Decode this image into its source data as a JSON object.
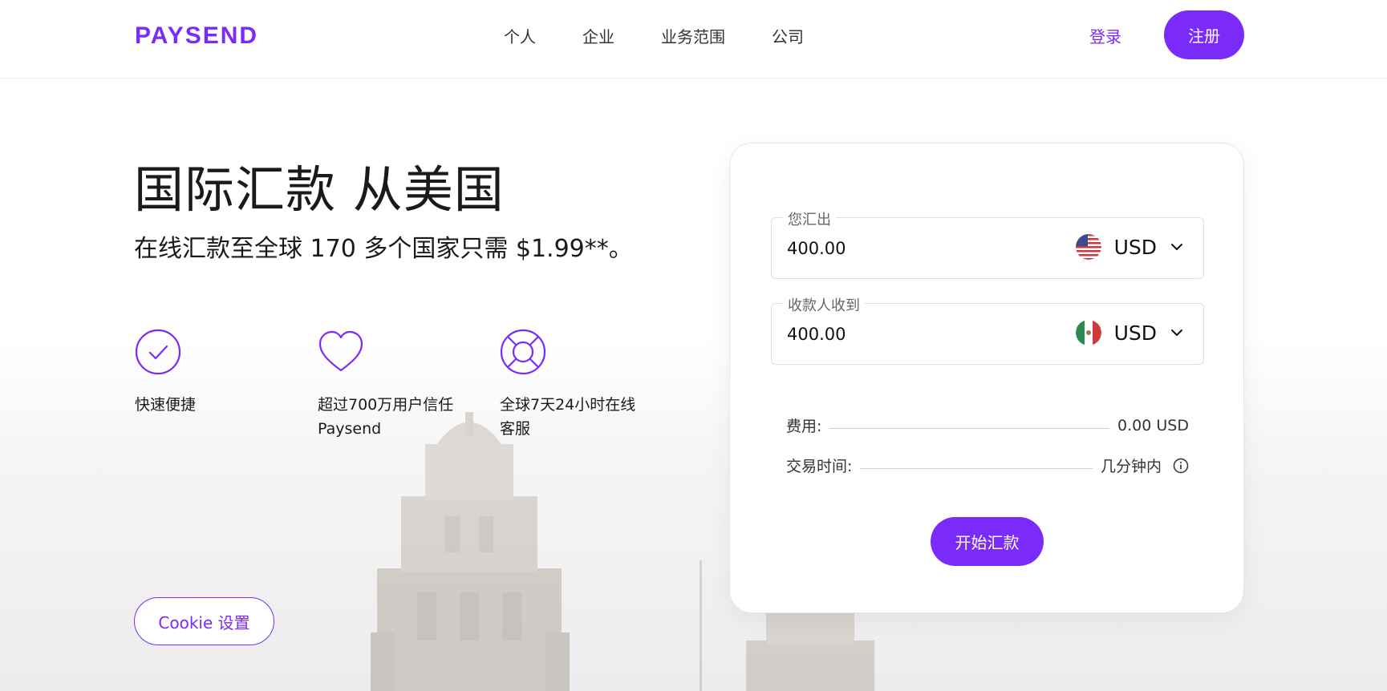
{
  "header": {
    "logo": "PAYSEND",
    "nav": [
      "个人",
      "企业",
      "业务范围",
      "公司"
    ],
    "login": "登录",
    "register": "注册"
  },
  "hero": {
    "title": "国际汇款 从美国",
    "subtitle": "在线汇款至全球 170 多个国家只需 $1.99**。",
    "features": [
      {
        "icon": "check-circle-icon",
        "text_line1": "快速便捷",
        "text_line2": ""
      },
      {
        "icon": "heart-icon",
        "text_line1": "超过700万用户信任",
        "text_line2": "Paysend"
      },
      {
        "icon": "lifebuoy-icon",
        "text_line1": "全球7天24小时在线",
        "text_line2": "客服"
      }
    ]
  },
  "cookie": {
    "label": "Cookie 设置"
  },
  "calculator": {
    "send": {
      "label": "您汇出",
      "amount": "400.00",
      "currency": "USD",
      "flag": "us-flag-icon"
    },
    "receive": {
      "label": "收款人收到",
      "amount": "400.00",
      "currency": "USD",
      "flag": "mx-flag-icon"
    },
    "fee": {
      "label": "费用:",
      "value": "0.00 USD"
    },
    "time": {
      "label": "交易时间:",
      "value": "几分钟内"
    },
    "start": "开始汇款"
  },
  "colors": {
    "accent": "#7b2bf9",
    "text": "#1a1a1a"
  }
}
